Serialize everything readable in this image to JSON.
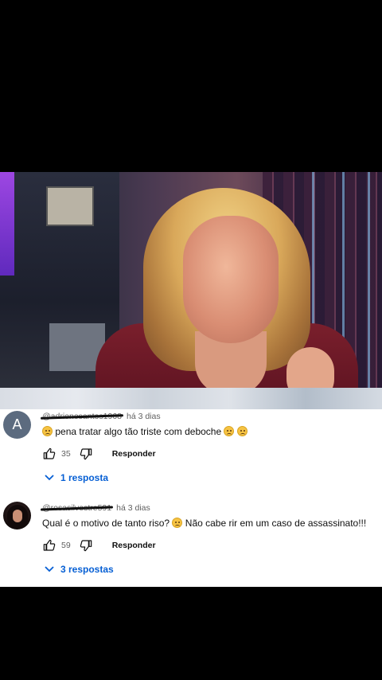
{
  "comments": [
    {
      "avatar_letter": "A",
      "handle": "@adrienesantos1968",
      "time": "há 3 dias",
      "text": "pena tratar algo tão triste com deboche",
      "likes": "35",
      "reply_label": "Responder",
      "replies_label": "1 resposta"
    },
    {
      "handle": "@rosasilvestre591",
      "time": "há 3 dias",
      "text_before": "Qual é o motivo de tanto riso?",
      "text_after": "Não cabe rir em um caso de assassinato!!!",
      "likes": "59",
      "reply_label": "Responder",
      "replies_label": "3 respostas"
    }
  ],
  "icons": [
    "like-icon",
    "dislike-icon",
    "chevron-down-icon",
    "sad-emoji-icon"
  ],
  "colors": {
    "link_blue": "#065fd4",
    "avatar_gray": "#5c6b7f",
    "text": "#0f0f0f",
    "muted": "#606060"
  }
}
